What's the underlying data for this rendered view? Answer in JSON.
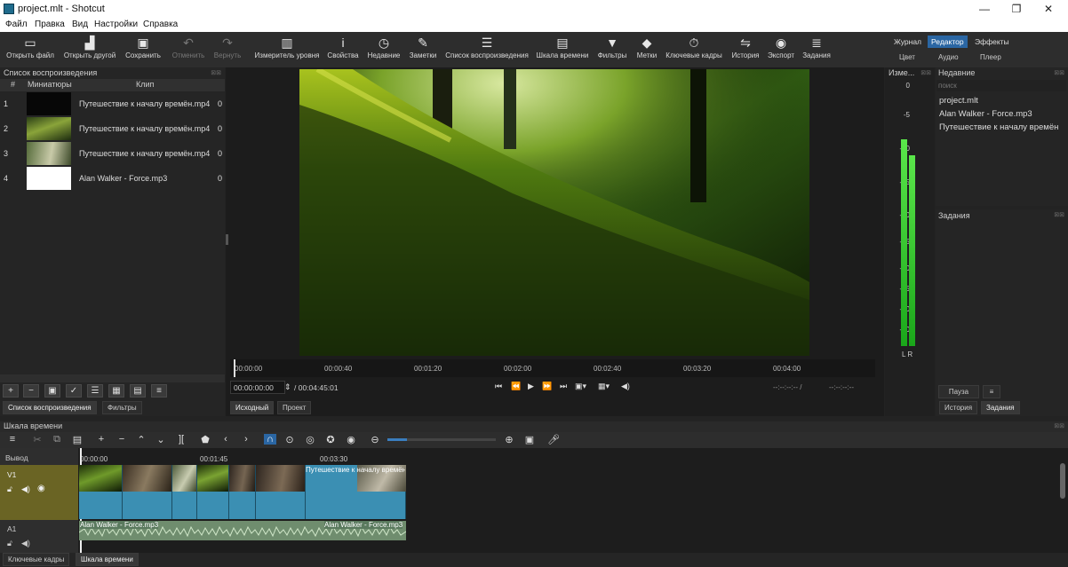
{
  "window": {
    "title": "project.mlt - Shotcut",
    "minimize": "—",
    "maximize": "❐",
    "close": "✕"
  },
  "menu": [
    "Файл",
    "Правка",
    "Вид",
    "Настройки",
    "Справка"
  ],
  "toolbar": [
    {
      "label": "Открыть файл",
      "icon": "▭"
    },
    {
      "label": "Открыть другой",
      "icon": "▟"
    },
    {
      "label": "Сохранить",
      "icon": "▣"
    },
    {
      "label": "Отменить",
      "icon": "↶"
    },
    {
      "label": "Вернуть",
      "icon": "↷"
    },
    {
      "label": "Измеритель уровня",
      "icon": "▥"
    },
    {
      "label": "Свойства",
      "icon": "i"
    },
    {
      "label": "Недавние",
      "icon": "◷"
    },
    {
      "label": "Заметки",
      "icon": "✎"
    },
    {
      "label": "Список воспроизведения",
      "icon": "☰"
    },
    {
      "label": "Шкала времени",
      "icon": "▤"
    },
    {
      "label": "Фильтры",
      "icon": "▼"
    },
    {
      "label": "Метки",
      "icon": "◆"
    },
    {
      "label": "Ключевые кадры",
      "icon": "⏱"
    },
    {
      "label": "История",
      "icon": "⇋"
    },
    {
      "label": "Экспорт",
      "icon": "◉"
    },
    {
      "label": "Задания",
      "icon": "≣"
    }
  ],
  "layouts": {
    "top": [
      "Журнал",
      "Редактор",
      "Эффекты"
    ],
    "sub": [
      "Цвет",
      "Аудио",
      "Плеер"
    ]
  },
  "playlist": {
    "title": "Список воспроизведения",
    "columns": [
      "#",
      "Миниатюры",
      "Клип"
    ],
    "rows": [
      {
        "n": "1",
        "clip": "Путешествие к началу времён.mp4",
        "z": "0"
      },
      {
        "n": "2",
        "clip": "Путешествие к началу времён.mp4",
        "z": "0"
      },
      {
        "n": "3",
        "clip": "Путешествие к началу времён.mp4",
        "z": "0"
      },
      {
        "n": "4",
        "clip": "Alan Walker - Force.mp3",
        "z": "0"
      }
    ],
    "tabs": [
      "Список воспроизведения",
      "Фильтры"
    ]
  },
  "viewer": {
    "ruler": [
      "00:00:00",
      "00:00:40",
      "00:01:20",
      "00:02:00",
      "00:02:40",
      "00:03:20",
      "00:04:00"
    ],
    "timecode": "00:00:00:00",
    "duration": "/ 00:04:45:01",
    "in_out_a": "--:--:--:-- /",
    "in_out_b": "--:--:--:--",
    "tabs": [
      "Исходный",
      "Проект"
    ]
  },
  "meter": {
    "title": "Изме...",
    "labels": [
      "0",
      "-5",
      "-10",
      "-15",
      "-20",
      "-25",
      "-30",
      "-35",
      "-40",
      "-50"
    ],
    "lr": "L  R"
  },
  "recent": {
    "title": "Недавние",
    "search_placeholder": "поиск",
    "items": [
      "project.mlt",
      "Alan Walker - Force.mp3",
      "Путешествие к началу времён"
    ]
  },
  "jobs": {
    "title": "Задания",
    "pause": "Пауза",
    "tabs": [
      "История",
      "Задания"
    ]
  },
  "timeline": {
    "title": "Шкала времени",
    "output": "Вывод",
    "v1": "V1",
    "a1": "A1",
    "ruler": [
      "00:00:00",
      "00:01:45",
      "00:03:30"
    ],
    "clip_title": "Путешествие к началу времён",
    "audio_a": "Alan Walker - Force.mp3",
    "audio_b": "Alan Walker - Force.mp3"
  },
  "bottom_tabs": [
    "Ключевые кадры",
    "Шкала времени"
  ]
}
